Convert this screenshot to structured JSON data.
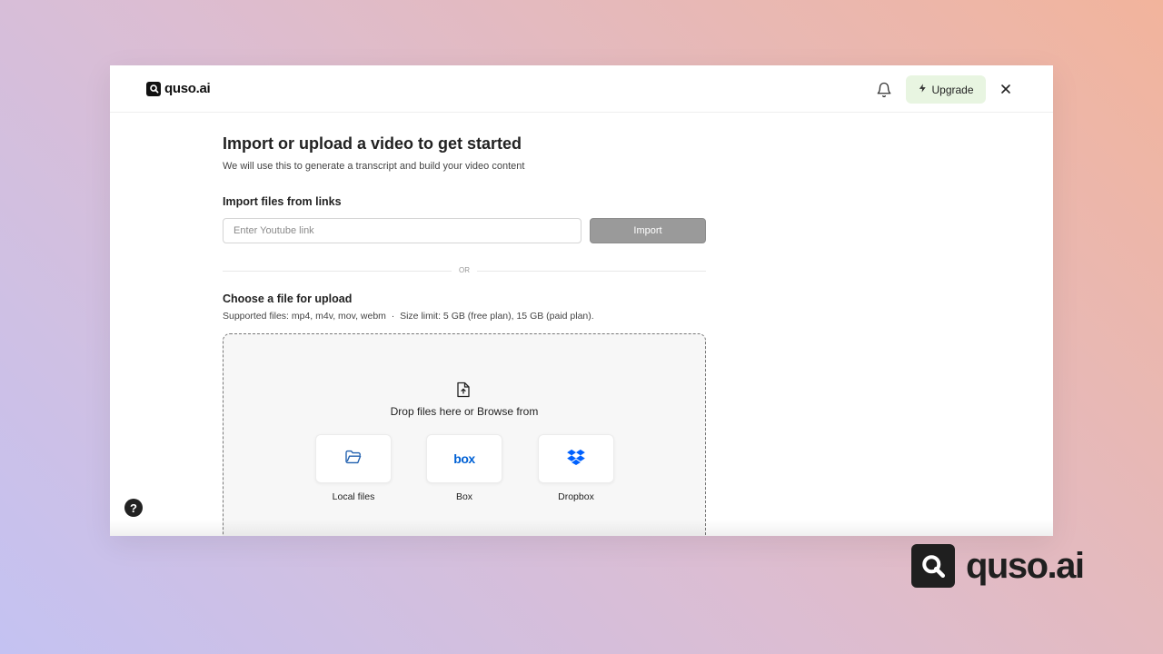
{
  "app": {
    "logo_text": "quso.ai",
    "upgrade_label": "Upgrade"
  },
  "header": {
    "icons": [
      "bell-icon",
      "lightning-icon",
      "close-icon"
    ]
  },
  "main": {
    "title": "Import or upload a video to get started",
    "subtitle": "We will use this to generate a transcript and build your video content",
    "import_section_title": "Import files from links",
    "link_input_placeholder": "Enter Youtube link",
    "link_input_value": "",
    "import_button_label": "Import",
    "divider_label": "OR",
    "upload_section_title": "Choose a file for upload",
    "supported_text": "Supported files: mp4, m4v, mov, webm  ·  Size limit: 5 GB (free plan), 15 GB (paid plan).",
    "drop_text": "Drop files here or Browse from",
    "sources": [
      {
        "label": "Local files",
        "icon": "folder-icon"
      },
      {
        "label": "Box",
        "icon": "box-logo-icon",
        "logo_text": "box"
      },
      {
        "label": "Dropbox",
        "icon": "dropbox-icon"
      }
    ]
  },
  "footer_brand": {
    "text": "quso.ai"
  },
  "colors": {
    "upgrade_bg": "#e8f5e1",
    "import_button_bg": "#9a9a9a",
    "box_blue": "#0061d5",
    "dropbox_blue": "#0061fe"
  }
}
